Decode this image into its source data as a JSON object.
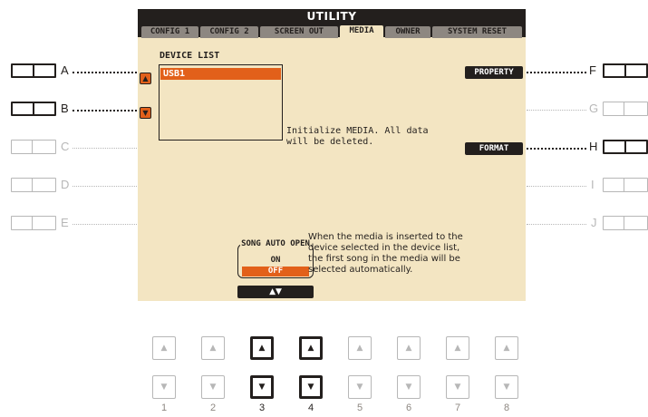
{
  "screen": {
    "title": "UTILITY",
    "tabs": [
      "CONFIG 1",
      "CONFIG 2",
      "SCREEN OUT",
      "MEDIA",
      "OWNER",
      "SYSTEM RESET"
    ],
    "active_tab": "MEDIA",
    "device_list": {
      "label": "DEVICE LIST",
      "items": [
        "USB1"
      ]
    },
    "format_message": "Initialize MEDIA. All data\nwill be deleted.",
    "property_label": "PROPERTY",
    "format_label": "FORMAT",
    "song_auto_open": {
      "label": "SONG AUTO OPEN",
      "options": [
        "ON",
        "OFF"
      ],
      "selected": "OFF",
      "arrows": "▲▼"
    },
    "help_text": "When the media is inserted to the\ndevice selected in the device list,\nthe first song in the media will be\nselected automatically."
  },
  "side_buttons": {
    "left": [
      {
        "letter": "A",
        "active": true
      },
      {
        "letter": "B",
        "active": true
      },
      {
        "letter": "C",
        "active": false
      },
      {
        "letter": "D",
        "active": false
      },
      {
        "letter": "E",
        "active": false
      }
    ],
    "right": [
      {
        "letter": "F",
        "active": true
      },
      {
        "letter": "G",
        "active": false
      },
      {
        "letter": "H",
        "active": true
      },
      {
        "letter": "I",
        "active": false
      },
      {
        "letter": "J",
        "active": false
      }
    ]
  },
  "bottom_buttons": {
    "numbers": [
      "1",
      "2",
      "3",
      "4",
      "5",
      "6",
      "7",
      "8"
    ],
    "active": [
      "3",
      "4"
    ],
    "up_glyph": "▲",
    "down_glyph": "▼"
  },
  "colors": {
    "lcd_background": "#f3e5c2",
    "dark": "#231f1d",
    "accent_orange": "#e2601a",
    "inactive_gray": "#b7b7b7"
  }
}
